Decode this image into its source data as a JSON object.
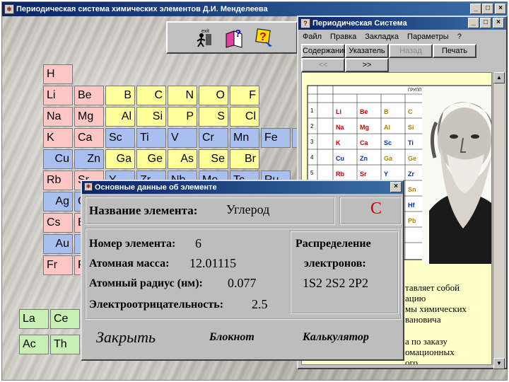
{
  "main_window": {
    "title": "Периодическая система химических элементов Д.И. Менделеева",
    "controls": [
      "_",
      "□",
      "×"
    ]
  },
  "toolbar": {
    "exit_label": "exit",
    "icons": [
      "exit-icon",
      "help-book-icon",
      "help-question-icon"
    ]
  },
  "periodic_table": {
    "rows": [
      [
        "H"
      ],
      [
        "Li",
        "Be",
        "B",
        "C",
        "N",
        "O",
        "F"
      ],
      [
        "Na",
        "Mg",
        "Al",
        "Si",
        "P",
        "S",
        "Cl"
      ],
      [
        "K",
        "Ca",
        "Sc",
        "Ti",
        "V",
        "Cr",
        "Mn",
        "Fe"
      ],
      [
        "Cu",
        "Zn",
        "Ga",
        "Ge",
        "As",
        "Se",
        "Br"
      ],
      [
        "Rb",
        "Sr",
        "Y",
        "Zr",
        "Nb",
        "Mo",
        "Tc",
        "Ru"
      ],
      [
        "Ag",
        "C"
      ],
      [
        "Cs",
        "B"
      ],
      [
        "Au"
      ],
      [
        "Fr",
        "R"
      ]
    ],
    "lanthanides": [
      "La",
      "Ce"
    ],
    "actinides": [
      "Ac",
      "Th"
    ]
  },
  "help_window": {
    "title": "Периодическая Система",
    "controls": [
      "_",
      "□",
      "×"
    ],
    "menu": [
      "Файл",
      "Правка",
      "Закладка",
      "Параметры",
      "?"
    ],
    "buttons": {
      "contents": "Содержание",
      "index": "Указатель",
      "back": "Назад",
      "print": "Печать",
      "prev": "<<",
      "next": ">>"
    },
    "table_header": "ГРУППЫ ЭЛЕМЕНТОВ",
    "text_lines": [
      "тавляет собой",
      "ацию",
      "мы химических",
      "вановича",
      "а по заказу",
      "омационных",
      "ого"
    ]
  },
  "element_dialog": {
    "title": "Основные данные об элементе",
    "close_glyph": "×",
    "name_label": "Название элемента:",
    "name_value": "Углерод",
    "symbol": "C",
    "number_label": "Номер элемента:",
    "number_value": "6",
    "mass_label": "Атомная масса:",
    "mass_value": "12.01115",
    "radius_label": "Атомный радиус (нм):",
    "radius_value": "0.077",
    "electroneg_label": "Электроотрицательность:",
    "electroneg_value": "2.5",
    "distribution_label_1": "Распределение",
    "distribution_label_2": "электронов:",
    "distribution_value": "1S2 2S2 2P2",
    "close_button": "Закрыть",
    "notepad_button": "Блокнот",
    "calculator_button": "Калькулятор"
  },
  "colors": {
    "s_block": "#ffc6c6",
    "p_block": "#ffff99",
    "d_block": "#a8bff0",
    "f_block": "#c8f0b4",
    "title_bar": "#0a246a",
    "symbol_red": "#d00000"
  }
}
